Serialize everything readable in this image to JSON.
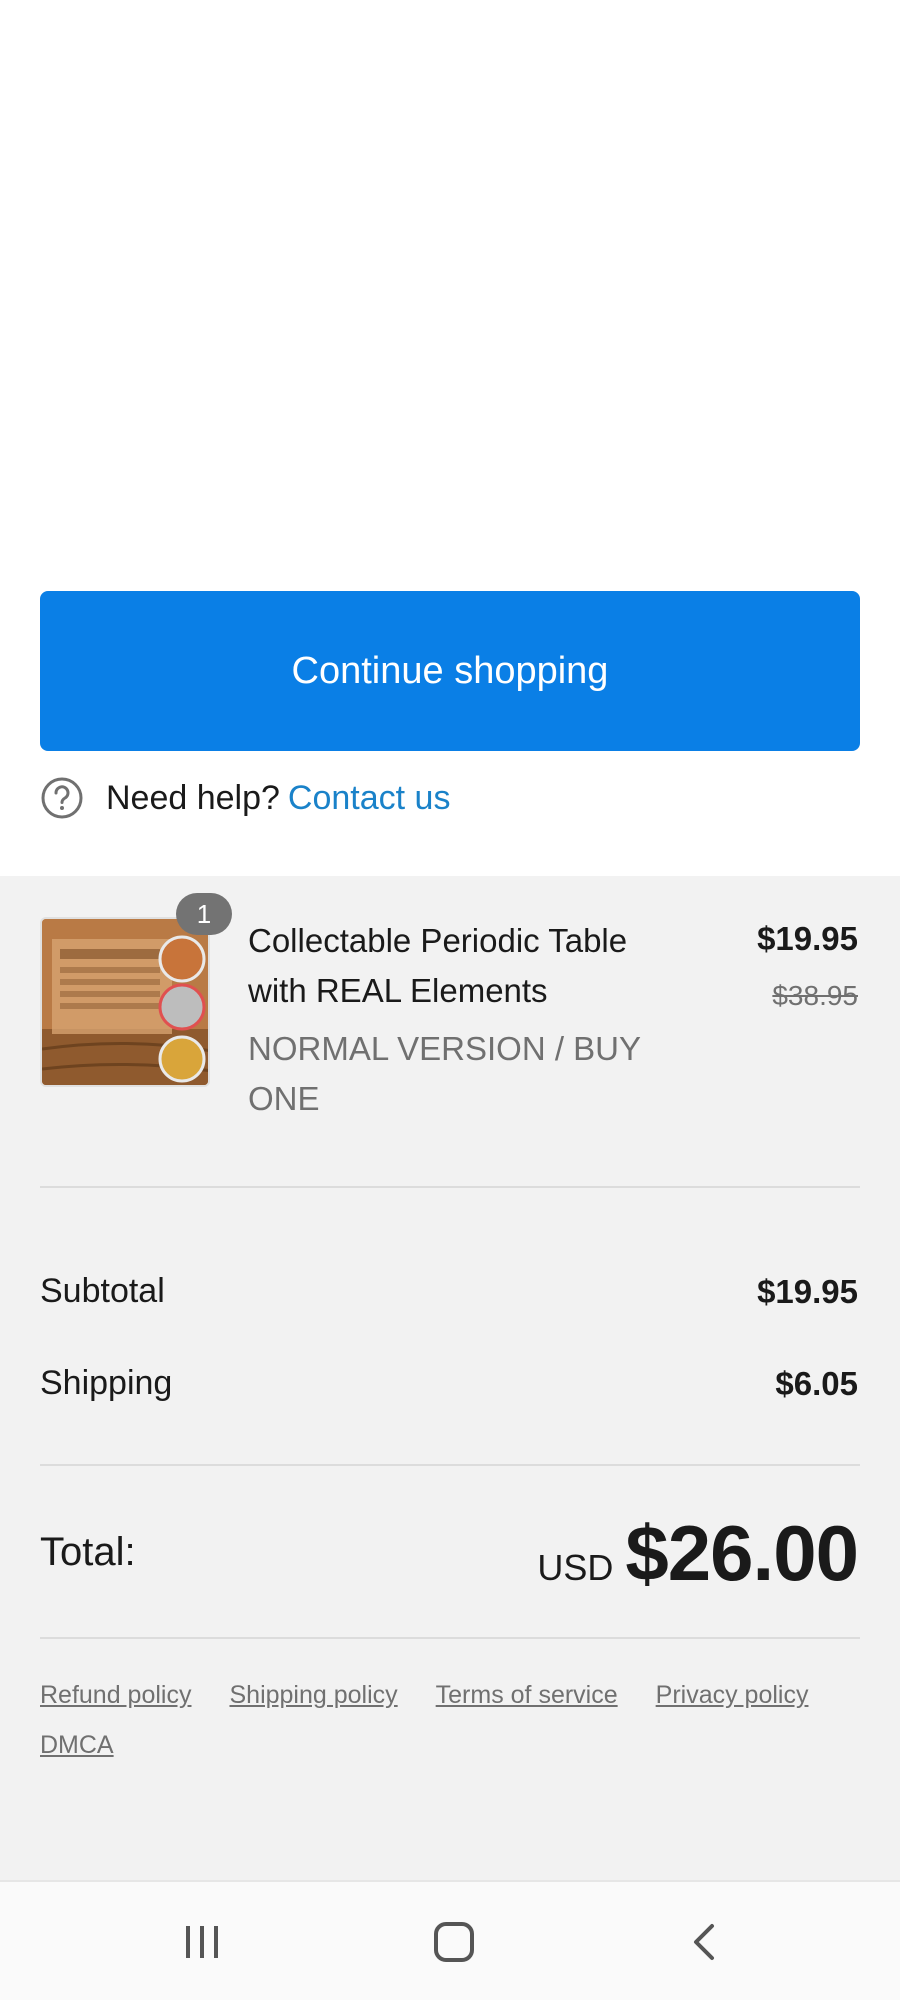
{
  "actions": {
    "continue_label": "Continue shopping"
  },
  "help": {
    "text": "Need help?",
    "link": "Contact us",
    "icon": "help-circle-icon"
  },
  "order": {
    "items": [
      {
        "title": "Collectable Periodic Table with REAL Elements",
        "variant": "NORMAL VERSION / BUY ONE",
        "quantity": "1",
        "price": "$19.95",
        "compare_at_price": "$38.95"
      }
    ],
    "subtotal_label": "Subtotal",
    "subtotal_value": "$19.95",
    "shipping_label": "Shipping",
    "shipping_value": "$6.05",
    "total_label": "Total:",
    "currency": "USD",
    "total_value": "$26.00"
  },
  "footer": {
    "links": [
      "Refund policy",
      "Shipping policy",
      "Terms of service",
      "Privacy policy",
      "DMCA"
    ]
  },
  "navbar": {
    "icons": [
      "recent-apps-icon",
      "home-icon",
      "back-icon"
    ]
  },
  "colors": {
    "accent": "#0a7fe6",
    "link": "#1a82c9",
    "summary_bg": "#f2f2f2"
  }
}
